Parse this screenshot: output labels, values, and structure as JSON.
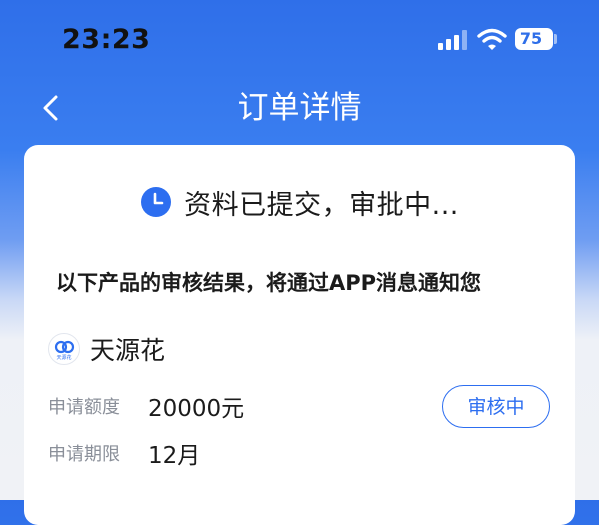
{
  "status_bar": {
    "time": "23:23",
    "battery": "75",
    "icons": [
      "signal-icon",
      "wifi-icon",
      "battery-icon"
    ]
  },
  "nav": {
    "title": "订单详情",
    "back_icon": "chevron-left-icon"
  },
  "order": {
    "status_text": "资料已提交，审批中...",
    "notice": "以下产品的审核结果，将通过APP消息通知您",
    "product": {
      "name": "天源花",
      "logo_text": "天源花"
    },
    "amount_label": "申请额度",
    "amount_value": "20000元",
    "term_label": "申请期限",
    "term_value": "12月",
    "review_status": "审核中"
  },
  "colors": {
    "brand_blue": "#2f6fe9",
    "accent": "#2d6ef0"
  }
}
